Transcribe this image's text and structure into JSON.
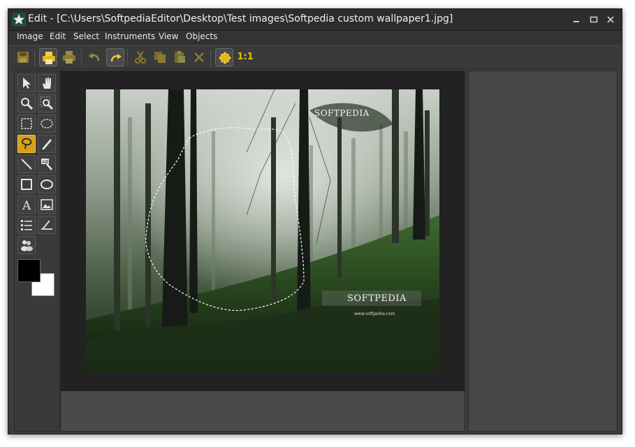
{
  "window": {
    "title": "Edit - [C:\\Users\\SoftpediaEditor\\Desktop\\Test images\\Softpedia custom wallpaper1.jpg]"
  },
  "menu": {
    "items": [
      "Image",
      "Edit",
      "Select",
      "Instruments",
      "View",
      "Objects"
    ]
  },
  "toolbar": {
    "zoom_actual_label": "1:1"
  },
  "image": {
    "watermark_top": "SOFTPEDIA",
    "watermark_bottom": "SOFTPEDIA",
    "watermark_url": "www.softpedia.com"
  },
  "colors": {
    "foreground": "#000000",
    "background": "#ffffff",
    "selected_tool": "#d4a017"
  }
}
